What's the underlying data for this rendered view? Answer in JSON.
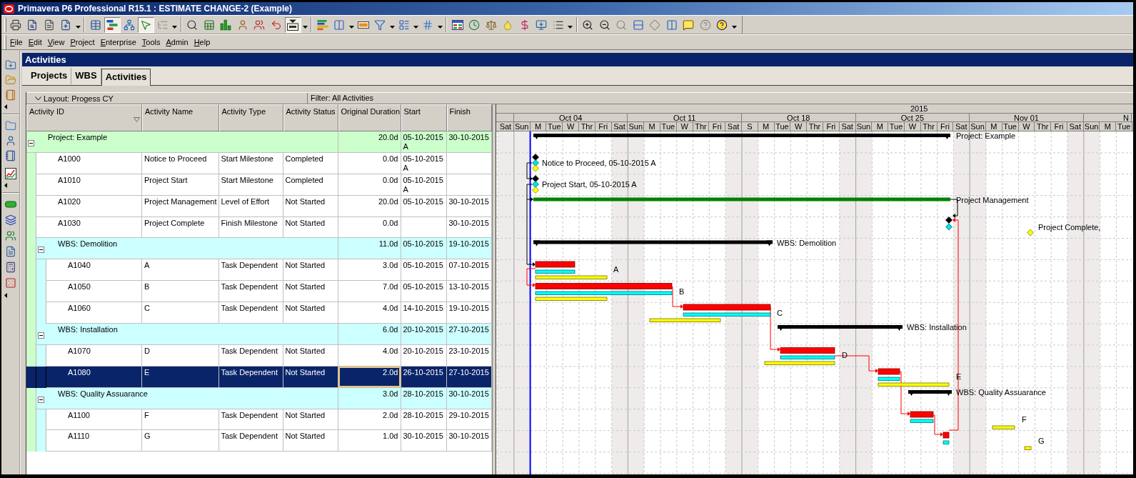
{
  "window": {
    "title": "Primavera P6 Professional R15.1 : ESTIMATE CHANGE-2 (Example)"
  },
  "toolbar": [
    [
      {
        "kind": "button",
        "pressed": false,
        "disabled": false
      },
      {
        "kind": "button",
        "pressed": false,
        "disabled": false
      },
      {
        "kind": "button",
        "pressed": false,
        "disabled": false
      },
      {
        "kind": "button",
        "pressed": false,
        "disabled": false
      },
      {
        "kind": "menu_arrow"
      }
    ],
    [
      {
        "kind": "button",
        "pressed": false,
        "disabled": false
      },
      {
        "kind": "button",
        "pressed": true,
        "disabled": false
      },
      {
        "kind": "button",
        "pressed": false,
        "disabled": false
      },
      {
        "kind": "button",
        "pressed": true,
        "disabled": false
      },
      {
        "kind": "button",
        "pressed": false,
        "disabled": true
      },
      {
        "kind": "menu_arrow"
      }
    ],
    [
      {
        "kind": "button",
        "pressed": false,
        "disabled": false
      },
      {
        "kind": "button",
        "pressed": false,
        "disabled": false
      },
      {
        "kind": "button",
        "pressed": false,
        "disabled": false
      },
      {
        "kind": "button",
        "pressed": false,
        "disabled": false
      },
      {
        "kind": "button",
        "pressed": false,
        "disabled": false
      },
      {
        "kind": "button",
        "pressed": false,
        "disabled": false
      },
      {
        "kind": "button",
        "pressed": true,
        "disabled": false
      },
      {
        "kind": "menu_arrow"
      }
    ],
    [
      {
        "kind": "button",
        "pressed": false,
        "disabled": false
      },
      {
        "kind": "button",
        "pressed": false,
        "disabled": false
      },
      {
        "kind": "menu_arrow"
      },
      {
        "kind": "button",
        "pressed": false,
        "disabled": false
      },
      {
        "kind": "button",
        "pressed": false,
        "disabled": false
      },
      {
        "kind": "menu_arrow"
      },
      {
        "kind": "button",
        "pressed": false,
        "disabled": false
      },
      {
        "kind": "menu_arrow"
      },
      {
        "kind": "button",
        "pressed": false,
        "disabled": false
      },
      {
        "kind": "menu_arrow"
      }
    ],
    [
      {
        "kind": "button",
        "pressed": false,
        "disabled": false
      },
      {
        "kind": "button",
        "pressed": false,
        "disabled": false
      },
      {
        "kind": "button",
        "pressed": false,
        "disabled": false
      },
      {
        "kind": "button",
        "pressed": false,
        "disabled": false
      },
      {
        "kind": "button",
        "pressed": false,
        "disabled": false
      },
      {
        "kind": "button",
        "pressed": false,
        "disabled": false
      },
      {
        "kind": "button",
        "pressed": false,
        "disabled": false
      },
      {
        "kind": "menu_arrow"
      }
    ],
    [
      {
        "kind": "button",
        "pressed": false,
        "disabled": false
      },
      {
        "kind": "button",
        "pressed": false,
        "disabled": false
      },
      {
        "kind": "button",
        "pressed": false,
        "disabled": true
      },
      {
        "kind": "button",
        "pressed": false,
        "disabled": false
      },
      {
        "kind": "button",
        "pressed": false,
        "disabled": true
      },
      {
        "kind": "button",
        "pressed": false,
        "disabled": false
      },
      {
        "kind": "button",
        "pressed": false,
        "disabled": false
      },
      {
        "kind": "button",
        "pressed": false,
        "disabled": true
      },
      {
        "kind": "button",
        "pressed": false,
        "disabled": false
      },
      {
        "kind": "menu_arrow"
      }
    ]
  ],
  "menu": [
    "File",
    "Edit",
    "View",
    "Project",
    "Enterprise",
    "Tools",
    "Admin",
    "Help"
  ],
  "panel": {
    "title": "Activities"
  },
  "tabs": [
    {
      "label": "Projects",
      "selected": false
    },
    {
      "label": "WBS",
      "selected": false
    },
    {
      "label": "Activities",
      "selected": true
    }
  ],
  "table": {
    "layout": "Layout: Progess CY",
    "filter": "Filter: All Activities",
    "columns": [
      {
        "label": "Activity ID",
        "sorted": true
      },
      {
        "label": "Activity Name",
        "sorted": false
      },
      {
        "label": "Activity Type",
        "sorted": false
      },
      {
        "label": "Activity Status",
        "sorted": false
      },
      {
        "label": "Original Duration",
        "sorted": false
      },
      {
        "label": "Start",
        "sorted": false
      },
      {
        "label": "Finish",
        "sorted": false
      }
    ],
    "rows": [
      {
        "kind": "project",
        "name": "Project: Example",
        "duration": "20.0d",
        "start": "05-10-2015 A",
        "finish": "30-10-2015",
        "expanded": true,
        "selected": false,
        "children": [
          {
            "kind": "activity",
            "id": "A1000",
            "name": "Notice to Proceed",
            "type": "Start Milestone",
            "status": "Completed",
            "duration": "0.0d",
            "start": "05-10-2015 A",
            "selected": false
          },
          {
            "kind": "activity",
            "id": "A1010",
            "name": "Project Start",
            "type": "Start Milestone",
            "status": "Completed",
            "duration": "0.0d",
            "start": "05-10-2015 A",
            "selected": false
          },
          {
            "kind": "activity",
            "id": "A1020",
            "name": "Project Management",
            "type": "Level of Effort",
            "status": "Not Started",
            "duration": "20.0d",
            "start": "05-10-2015",
            "finish": "30-10-2015",
            "selected": false
          },
          {
            "kind": "activity",
            "id": "A1030",
            "name": "Project Complete",
            "type": "Finish Milestone",
            "status": "Not Started",
            "duration": "0.0d",
            "finish": "30-10-2015",
            "selected": false
          },
          {
            "kind": "wbs",
            "name": "WBS: Demolition",
            "duration": "11.0d",
            "start": "05-10-2015",
            "finish": "19-10-2015",
            "expanded": true,
            "selected": false,
            "children": [
              {
                "kind": "activity",
                "id": "A1040",
                "name": "A",
                "type": "Task Dependent",
                "status": "Not Started",
                "duration": "3.0d",
                "start": "05-10-2015",
                "finish": "07-10-2015",
                "selected": false
              },
              {
                "kind": "activity",
                "id": "A1050",
                "name": "B",
                "type": "Task Dependent",
                "status": "Not Started",
                "duration": "7.0d",
                "start": "05-10-2015",
                "finish": "13-10-2015",
                "selected": false
              },
              {
                "kind": "activity",
                "id": "A1060",
                "name": "C",
                "type": "Task Dependent",
                "status": "Not Started",
                "duration": "4.0d",
                "start": "14-10-2015",
                "finish": "19-10-2015",
                "selected": false
              }
            ]
          },
          {
            "kind": "wbs",
            "name": "WBS: Installation",
            "duration": "6.0d",
            "start": "20-10-2015",
            "finish": "27-10-2015",
            "expanded": true,
            "selected": false,
            "children": [
              {
                "kind": "activity",
                "id": "A1070",
                "name": "D",
                "type": "Task Dependent",
                "status": "Not Started",
                "duration": "4.0d",
                "start": "20-10-2015",
                "finish": "23-10-2015",
                "selected": false
              },
              {
                "kind": "activity",
                "id": "A1080",
                "name": "E",
                "type": "Task Dependent",
                "status": "Not Started",
                "duration": "2.0d",
                "start": "26-10-2015",
                "finish": "27-10-2015",
                "selected": true
              }
            ]
          },
          {
            "kind": "wbs",
            "name": "WBS: Quality Assuarance",
            "duration": "3.0d",
            "start": "28-10-2015",
            "finish": "30-10-2015",
            "expanded": true,
            "selected": false,
            "children": [
              {
                "kind": "activity",
                "id": "A1100",
                "name": "F",
                "type": "Task Dependent",
                "status": "Not Started",
                "duration": "2.0d",
                "start": "28-10-2015",
                "finish": "29-10-2015",
                "selected": false
              },
              {
                "kind": "activity",
                "id": "A1110",
                "name": "G",
                "type": "Task Dependent",
                "status": "Not Started",
                "duration": "1.0d",
                "start": "30-10-2015",
                "finish": "30-10-2015",
                "selected": false
              }
            ]
          }
        ]
      }
    ]
  },
  "gantt": {
    "year": "2015",
    "weeks": [
      "Oct 04",
      "Oct 11",
      "Oct 18",
      "Oct 25",
      "Nov 01",
      "N"
    ],
    "days": [
      "Sat",
      "Sun",
      "M",
      "Tue",
      "W",
      "Thr",
      "Fri",
      "Sat",
      "Sun",
      "M",
      "Tue",
      "W",
      "Thr",
      "Fri",
      "Sat",
      "S",
      "M",
      "Tue",
      "W",
      "Thr",
      "Fri",
      "Sat",
      "Sun",
      "M",
      "Tue",
      "W",
      "Thr",
      "Fri",
      "Sat",
      "Sun",
      "M",
      "Tue",
      "W",
      "Thr",
      "Fri",
      "Sat",
      "Sun",
      "M",
      "Tue"
    ],
    "rows": [
      {
        "kind": "summary",
        "label": "Project: Example"
      },
      {
        "kind": "milestone",
        "label": "Notice to Proceed, 05-10-2015 A"
      },
      {
        "kind": "milestone",
        "label": "Project Start, 05-10-2015 A"
      },
      {
        "kind": "loe",
        "label": "Project Management"
      },
      {
        "kind": "milestone",
        "label": "Project Complete,"
      },
      {
        "kind": "summary",
        "label": "WBS: Demolition"
      },
      {
        "kind": "task",
        "label": "A"
      },
      {
        "kind": "task",
        "label": "B"
      },
      {
        "kind": "task",
        "label": "C"
      },
      {
        "kind": "summary",
        "label": "WBS: Installation"
      },
      {
        "kind": "task",
        "label": "D"
      },
      {
        "kind": "task",
        "label": "E"
      },
      {
        "kind": "summary",
        "label": "WBS: Quality Assuarance"
      },
      {
        "kind": "task",
        "label": "F"
      },
      {
        "kind": "task",
        "label": "G"
      }
    ]
  }
}
